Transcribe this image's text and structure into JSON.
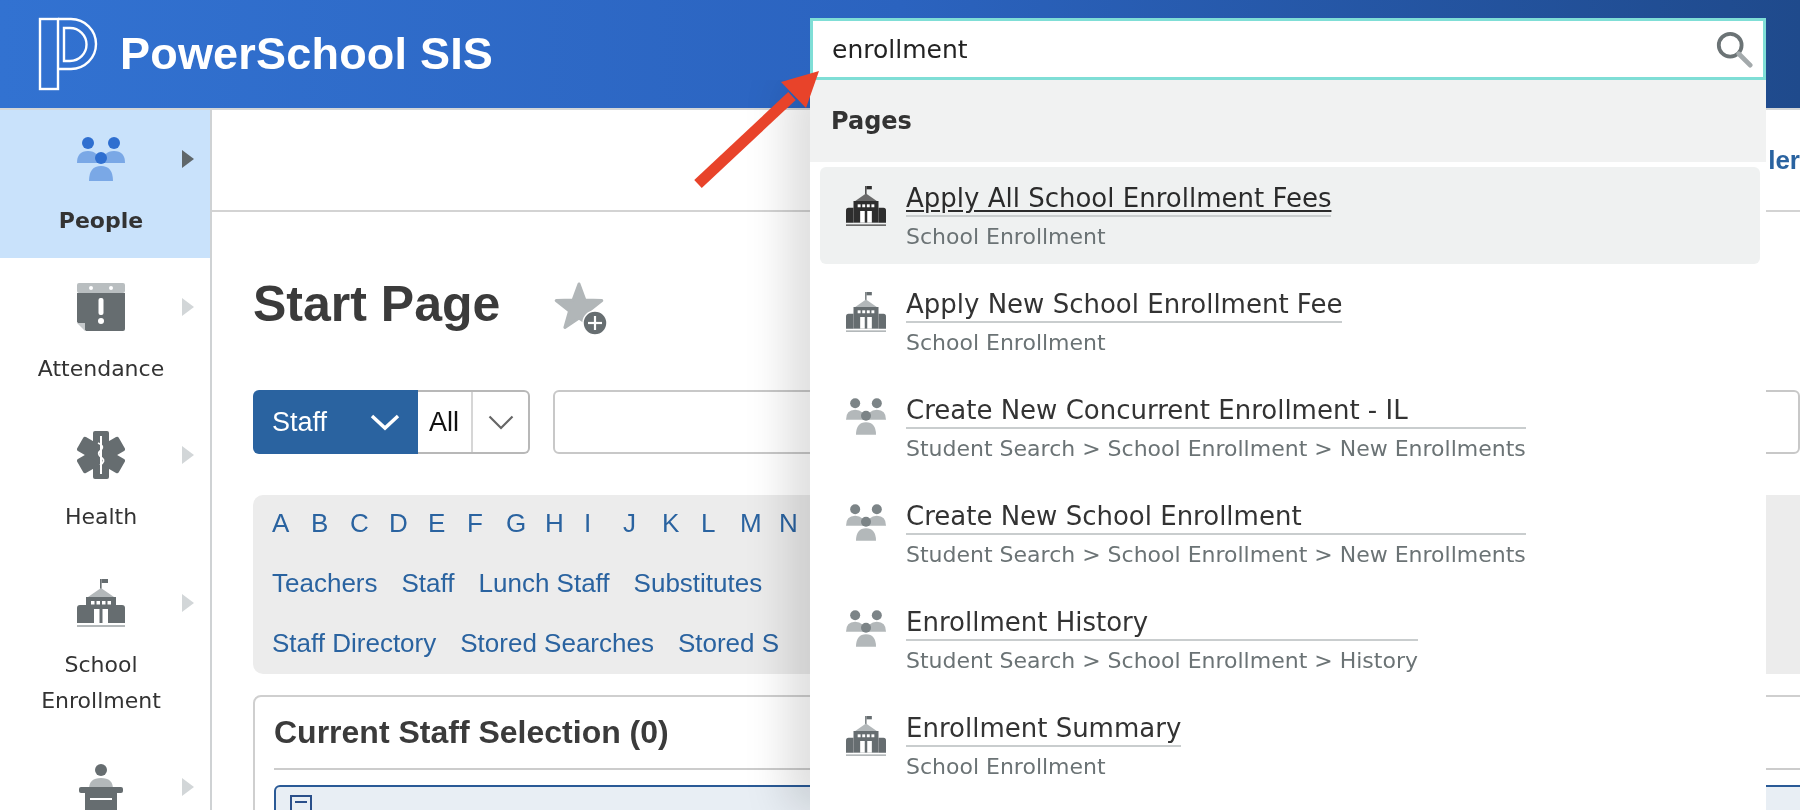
{
  "header": {
    "title": "PowerSchool SIS",
    "search": {
      "value": "enrollment",
      "results": {
        "heading": "Pages",
        "items": [
          {
            "kind": "school",
            "title": "Apply All School Enrollment Fees",
            "path": "School Enrollment",
            "selected": true
          },
          {
            "kind": "school",
            "title": "Apply New School Enrollment Fee",
            "path": "School Enrollment",
            "selected": false
          },
          {
            "kind": "student",
            "title": "Create New Concurrent Enrollment - IL",
            "path": "Student Search > School Enrollment > New Enrollments",
            "selected": false
          },
          {
            "kind": "student",
            "title": "Create New School Enrollment",
            "path": "Student Search > School Enrollment > New Enrollments",
            "selected": false
          },
          {
            "kind": "student",
            "title": "Enrollment History",
            "path": "Student Search > School Enrollment > History",
            "selected": false
          },
          {
            "kind": "school",
            "title": "Enrollment Summary",
            "path": "School Enrollment",
            "selected": false
          }
        ]
      }
    }
  },
  "sidebar": {
    "items": [
      {
        "label": "People",
        "selected": true
      },
      {
        "label": "Attendance",
        "selected": false
      },
      {
        "label": "Health",
        "selected": false
      },
      {
        "label": "School Enrollment",
        "selected": false
      },
      {
        "selected": false
      }
    ]
  },
  "top_bar": {
    "link": "ler"
  },
  "page": {
    "title": "Start Page",
    "record_type": "Staff",
    "scope": "All",
    "letters": [
      "A",
      "B",
      "C",
      "D",
      "E",
      "F",
      "G",
      "H",
      "I",
      "J",
      "K",
      "L",
      "M",
      "N"
    ],
    "group_links": [
      "Teachers",
      "Staff",
      "Lunch Staff",
      "Substitutes"
    ],
    "more_links": [
      "Staff Directory",
      "Stored Searches",
      "Stored S"
    ],
    "selection": {
      "title": "Current Staff Selection (0)"
    }
  }
}
